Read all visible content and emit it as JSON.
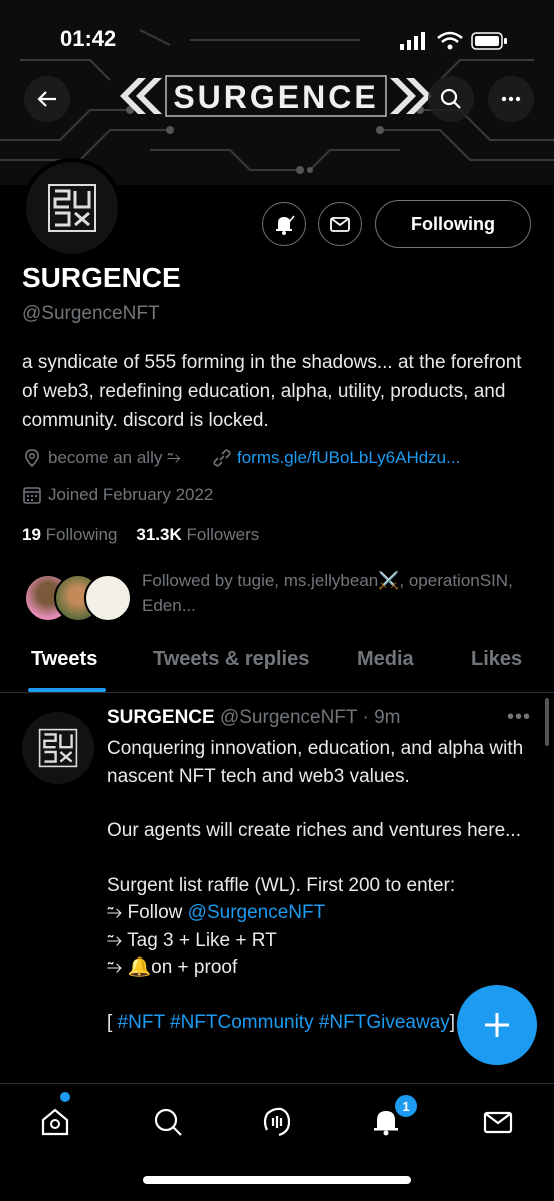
{
  "status": {
    "time": "01:42"
  },
  "banner": {
    "word": "SURGENCE"
  },
  "profile": {
    "name": "SURGENCE",
    "handle": "@SurgenceNFT",
    "follow_button": "Following",
    "bio": "a syndicate of 555 forming in the shadows... at the forefront of web3, redefining education, alpha, utility, products, and community. discord is locked.",
    "location": "become an ally ⥲",
    "link": "forms.gle/fUBoLbLy6AHdzu...",
    "joined": "Joined February 2022",
    "following_count": "19",
    "following_label": "Following",
    "followers_count": "31.3K",
    "followers_label": "Followers",
    "followed_by": "Followed by tugie, ms.jellybean⚔️, operationSIN, Eden..."
  },
  "tabs": [
    "Tweets",
    "Tweets & replies",
    "Media",
    "Likes"
  ],
  "tweet": {
    "name": "SURGENCE",
    "handle": "@SurgenceNFT",
    "time": "· 9m",
    "line1": "Conquering innovation, education, and alpha with nascent NFT tech and web3 values.",
    "line2": "Our agents will create riches and ventures here...",
    "line3": "Surgent list raffle (WL). First 200 to enter:",
    "follow_prefix": "⥲ Follow ",
    "follow_mention": "@SurgenceNFT",
    "tag_line": "⥲ Tag 3 + Like + RT",
    "bell_line": "⥲ 🔔on + proof",
    "hashtags_prefix": "[ ",
    "hashtags": "#NFT #NFTCommunity #NFTGiveaway",
    "hashtags_suffix": "]"
  },
  "nav": {
    "notification_count": "1"
  },
  "colors": {
    "accent": "#1d9bf0",
    "background": "#000000",
    "muted": "#71767b"
  }
}
